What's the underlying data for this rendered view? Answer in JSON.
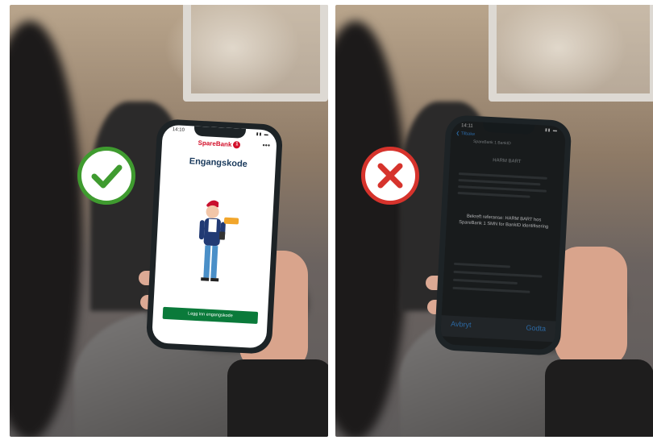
{
  "left_panel": {
    "phone": {
      "time": "14:10",
      "brand": "SpareBank",
      "brand_mark": "1",
      "menu": "•••",
      "title": "Engangskode",
      "button_label": "Legg inn engangskode"
    },
    "badge_icon": "checkmark-icon",
    "badge_color": "#3f9b2f"
  },
  "right_panel": {
    "phone": {
      "time": "14:11",
      "back_label": "❮ Tilbake",
      "header_line": "SpareBank 1 BankID",
      "screen_title": "HARM BART",
      "confirm_text": "Bekreft referanse: HARM BART hos SpareBank 1 SMN for BankID identifisering",
      "cancel_label": "Avbryt",
      "accept_label": "Godta"
    },
    "badge_icon": "cross-icon",
    "badge_color": "#d6332c"
  }
}
